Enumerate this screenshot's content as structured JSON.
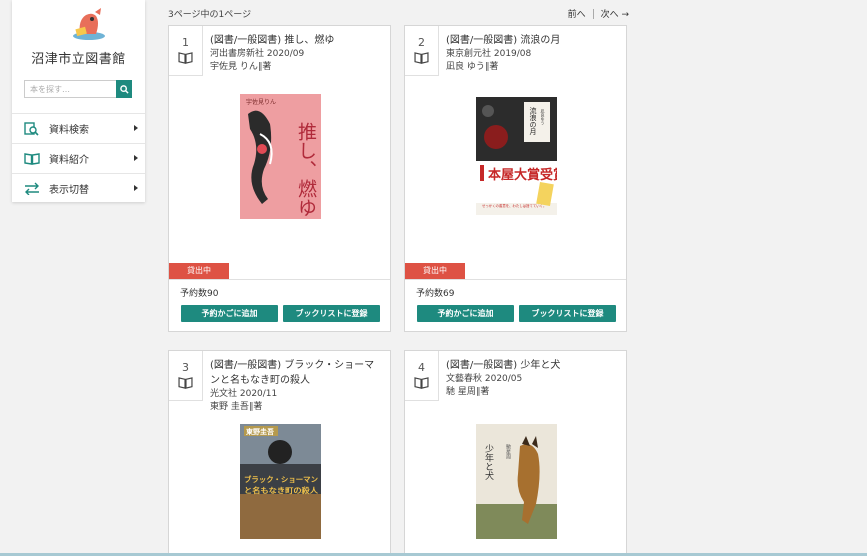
{
  "sidebar": {
    "library_name": "沼津市立図書館",
    "search_placeholder": "本を探す…",
    "menu": [
      {
        "label": "資料検索",
        "icon": "search-doc-icon"
      },
      {
        "label": "資料紹介",
        "icon": "open-book-icon"
      },
      {
        "label": "表示切替",
        "icon": "swap-arrows-icon"
      }
    ]
  },
  "topbar": {
    "page_info": "3ページ中の1ページ",
    "prev": "前へ",
    "next": "次へ →"
  },
  "books": [
    {
      "number": "1",
      "title": "(図書/一般図書) 推し、燃ゆ",
      "publisher": "河出書房新社 2020/09",
      "author": "宇佐見 りん∥著",
      "status": "貸出中",
      "reservations": "予約数90",
      "cover_author": "宇佐見りん",
      "cover_title": "推し、燃ゆ"
    },
    {
      "number": "2",
      "title": "(図書/一般図書) 流浪の月",
      "publisher": "東京創元社 2019/08",
      "author": "凪良 ゆう∥著",
      "status": "貸出中",
      "reservations": "予約数69",
      "cover_title": "流浪の月",
      "cover_author": "凪良ゆう",
      "cover_award": "本屋大賞受賞"
    },
    {
      "number": "3",
      "title": "(図書/一般図書) ブラック・ショーマンと名もなき町の殺人",
      "publisher": "光文社 2020/11",
      "author": "東野 圭吾∥著",
      "cover_author": "東野圭吾",
      "cover_title": "ブラック・ショーマンと名もなき町の殺人"
    },
    {
      "number": "4",
      "title": "(図書/一般図書) 少年と犬",
      "publisher": "文藝春秋 2020/05",
      "author": "馳 星周∥著",
      "cover_title": "少年と犬",
      "cover_author": "馳星周"
    }
  ],
  "buttons": {
    "add_reserve": "予約かごに追加",
    "add_booklist": "ブックリストに登録"
  },
  "colors": {
    "accent": "#1e8a7f",
    "status_red": "#de5244",
    "background": "#f2f2f2"
  }
}
